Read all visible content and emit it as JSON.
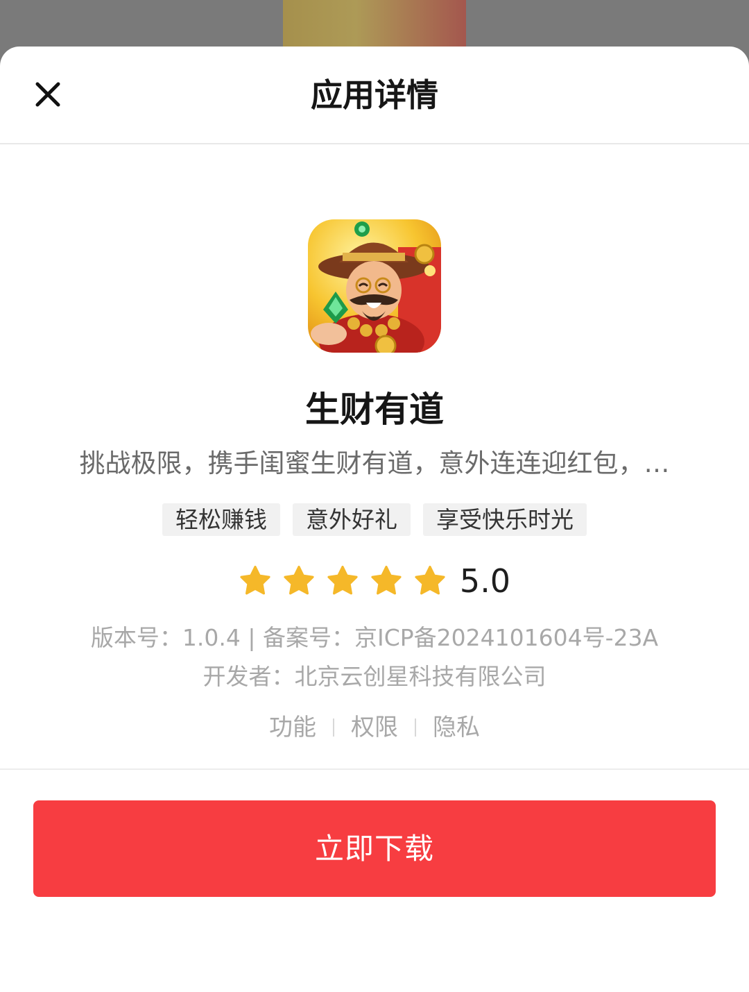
{
  "header": {
    "title": "应用详情"
  },
  "app": {
    "name": "生财有道",
    "description": "挑战极限，携手闺蜜生财有道，意外连连迎红包，…",
    "tags": [
      "轻松赚钱",
      "意外好礼",
      "享受快乐时光"
    ],
    "rating": {
      "stars": 5,
      "max_stars": 5,
      "score": "5.0"
    },
    "version_line": "版本号：1.0.4 | 备案号：京ICP备2024101604号-23A",
    "developer_line": "开发者：北京云创星科技有限公司"
  },
  "links": [
    "功能",
    "权限",
    "隐私"
  ],
  "download": {
    "label": "立即下载"
  },
  "colors": {
    "accent": "#f73d41",
    "star": "#f5b829"
  }
}
